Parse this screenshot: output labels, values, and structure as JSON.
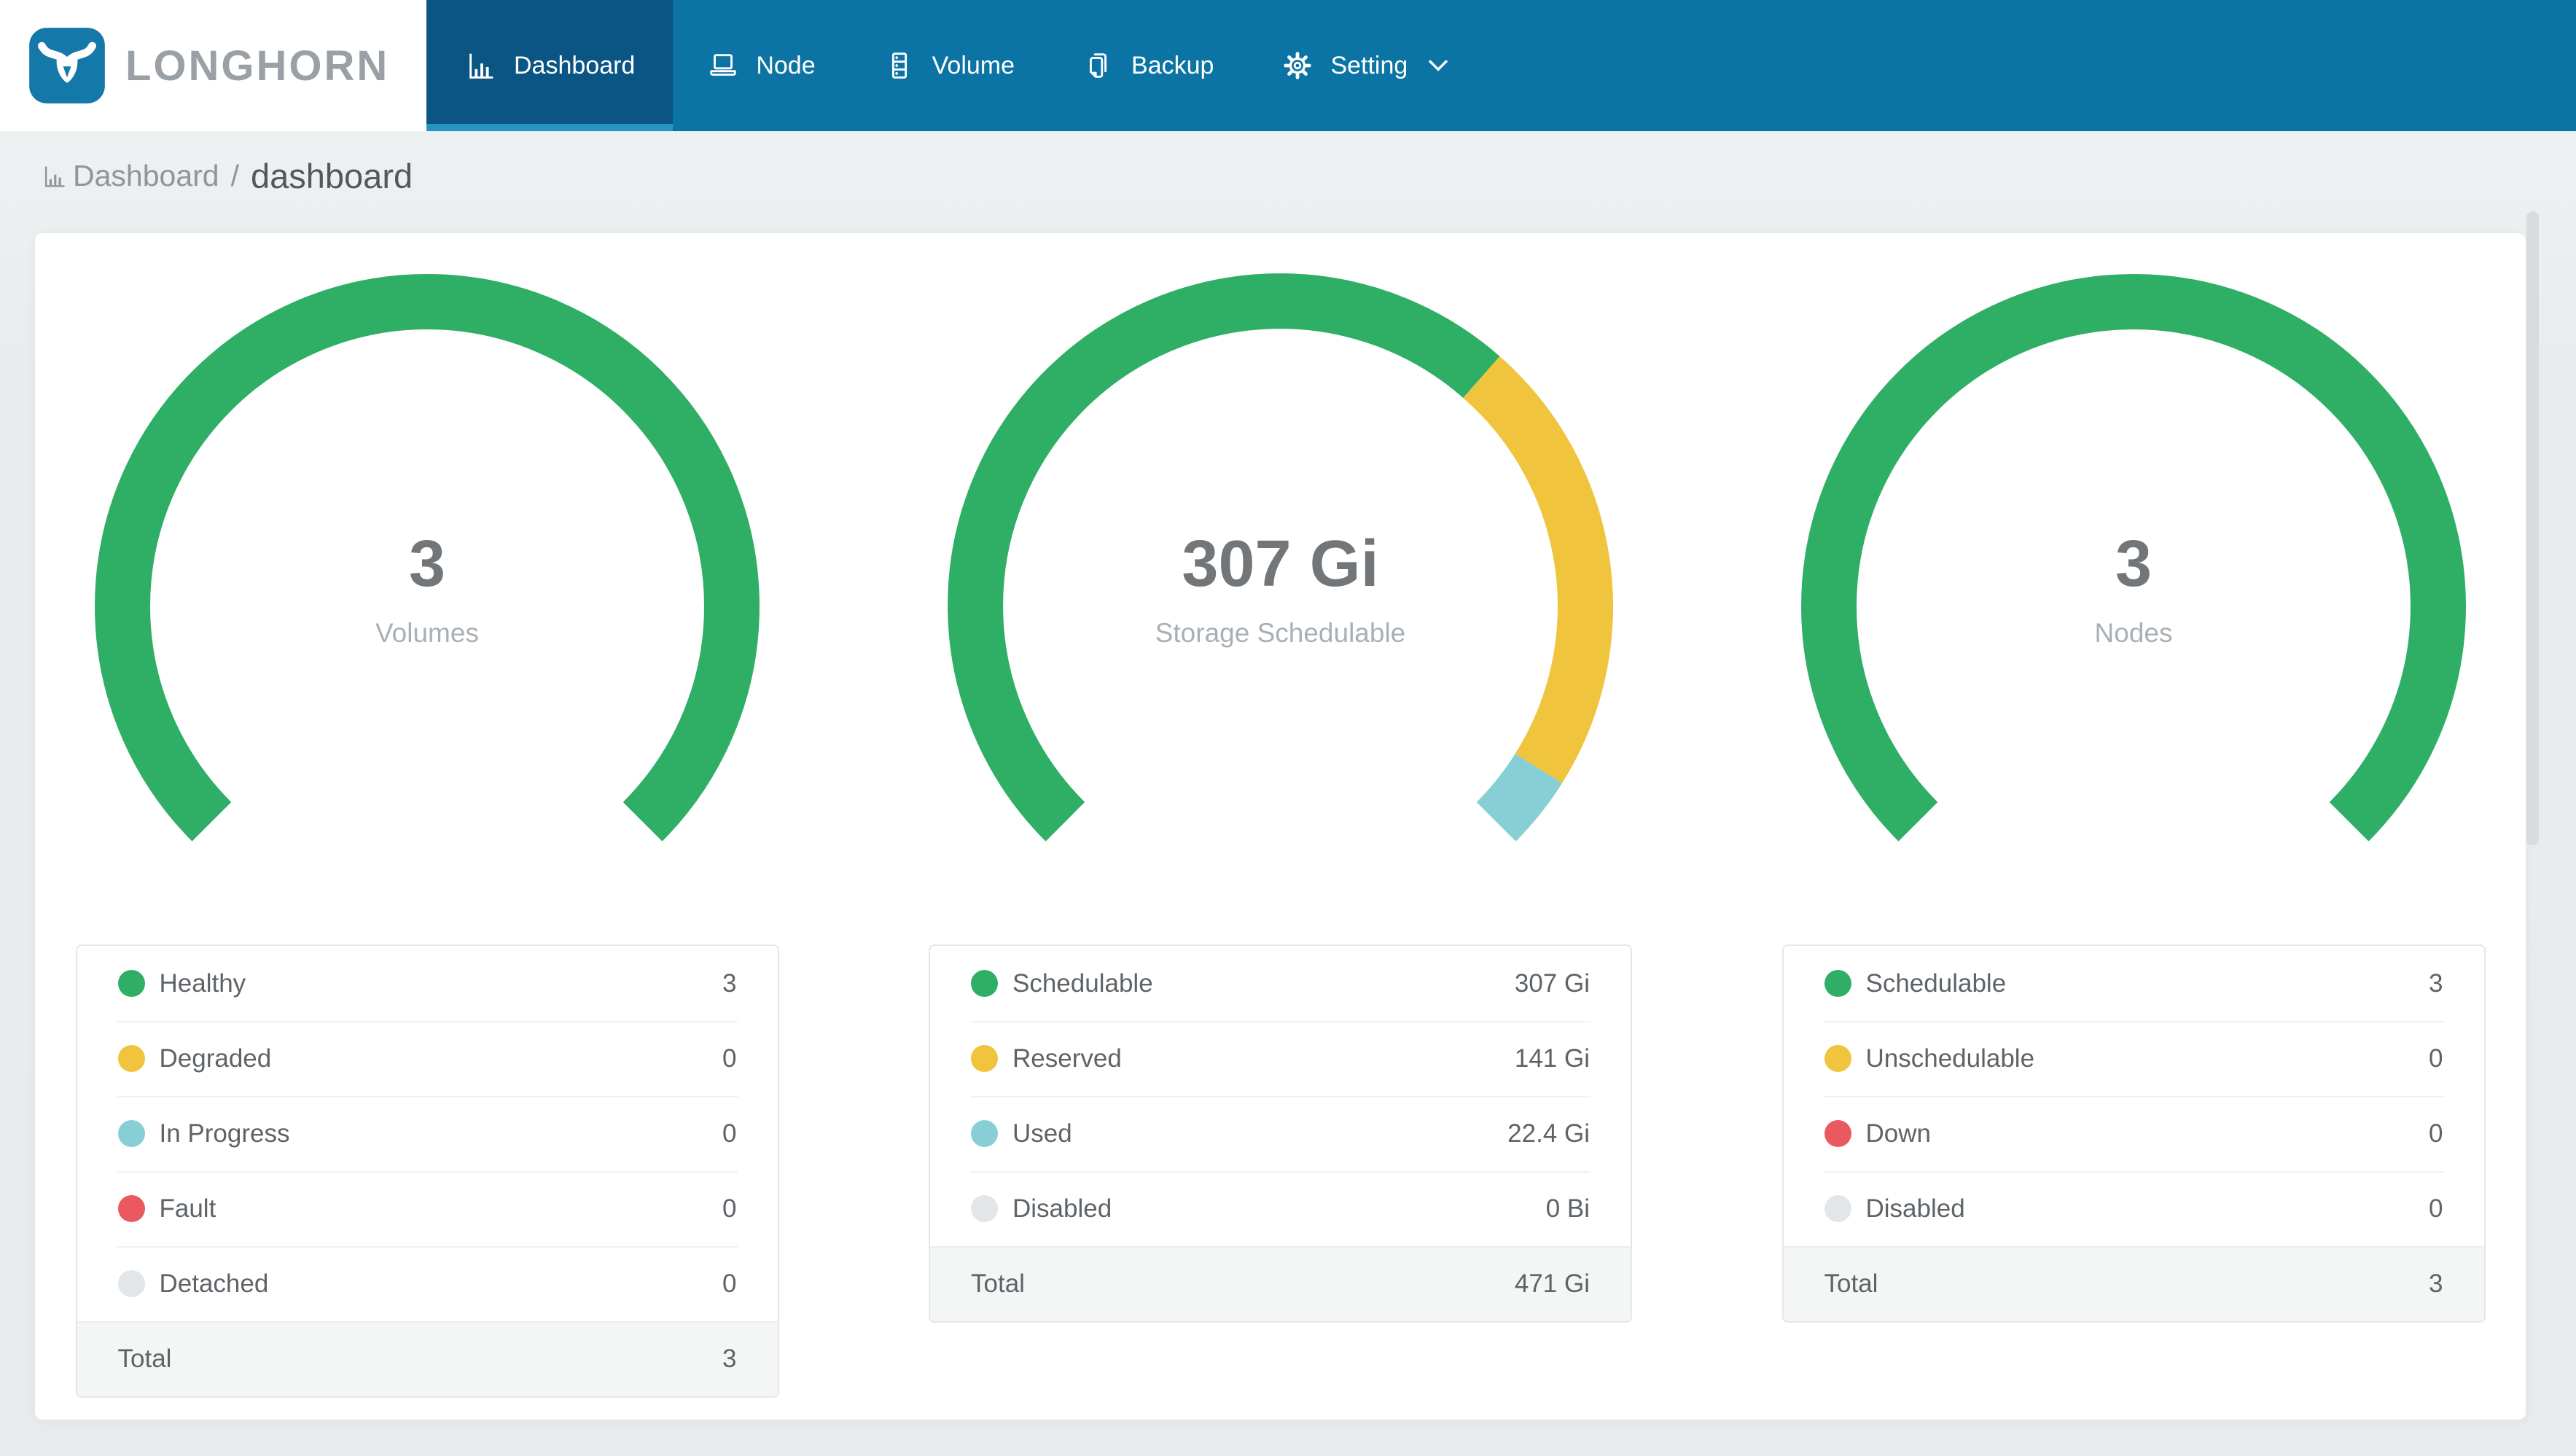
{
  "header": {
    "logo_text": "LONGHORN",
    "nav": [
      {
        "label": "Dashboard",
        "icon": "bar-chart",
        "active": true,
        "has_dropdown": false
      },
      {
        "label": "Node",
        "icon": "laptop",
        "active": false,
        "has_dropdown": false
      },
      {
        "label": "Volume",
        "icon": "server",
        "active": false,
        "has_dropdown": false
      },
      {
        "label": "Backup",
        "icon": "copy",
        "active": false,
        "has_dropdown": false
      },
      {
        "label": "Setting",
        "icon": "gear",
        "active": false,
        "has_dropdown": true
      }
    ]
  },
  "breadcrumb": {
    "section": "Dashboard",
    "separator": "/",
    "page": "dashboard",
    "icon": "bar-chart"
  },
  "colors": {
    "nav_bg": "#0b74a4",
    "nav_active_bg": "#0a5583",
    "nav_active_underline": "#2795c1",
    "green": "#2fae66",
    "yellow": "#f0c43c",
    "teal": "#87cfd5",
    "red": "#e9595f",
    "gray": "#e3e6e9"
  },
  "chart_data": [
    {
      "type": "gauge",
      "center_value": "3",
      "center_label": "Volumes",
      "arc_span_deg": 270,
      "segments": [
        {
          "label": "Healthy",
          "numeric": 3,
          "color_key": "green"
        }
      ],
      "legend_rows": [
        {
          "label": "Healthy",
          "value": "3",
          "color_key": "green"
        },
        {
          "label": "Degraded",
          "value": "0",
          "color_key": "yellow"
        },
        {
          "label": "In Progress",
          "value": "0",
          "color_key": "teal"
        },
        {
          "label": "Fault",
          "value": "0",
          "color_key": "red"
        },
        {
          "label": "Detached",
          "value": "0",
          "color_key": "gray"
        }
      ],
      "total": {
        "label": "Total",
        "value": "3"
      }
    },
    {
      "type": "gauge",
      "center_value": "307 Gi",
      "center_label": "Storage Schedulable",
      "arc_span_deg": 270,
      "segments": [
        {
          "label": "Schedulable",
          "numeric": 307,
          "color_key": "green"
        },
        {
          "label": "Reserved",
          "numeric": 141,
          "color_key": "yellow"
        },
        {
          "label": "Used",
          "numeric": 22.4,
          "color_key": "teal"
        }
      ],
      "legend_rows": [
        {
          "label": "Schedulable",
          "value": "307 Gi",
          "color_key": "green"
        },
        {
          "label": "Reserved",
          "value": "141 Gi",
          "color_key": "yellow"
        },
        {
          "label": "Used",
          "value": "22.4 Gi",
          "color_key": "teal"
        },
        {
          "label": "Disabled",
          "value": "0 Bi",
          "color_key": "gray"
        }
      ],
      "total": {
        "label": "Total",
        "value": "471 Gi"
      }
    },
    {
      "type": "gauge",
      "center_value": "3",
      "center_label": "Nodes",
      "arc_span_deg": 270,
      "segments": [
        {
          "label": "Schedulable",
          "numeric": 3,
          "color_key": "green"
        }
      ],
      "legend_rows": [
        {
          "label": "Schedulable",
          "value": "3",
          "color_key": "green"
        },
        {
          "label": "Unschedulable",
          "value": "0",
          "color_key": "yellow"
        },
        {
          "label": "Down",
          "value": "0",
          "color_key": "red"
        },
        {
          "label": "Disabled",
          "value": "0",
          "color_key": "gray"
        }
      ],
      "total": {
        "label": "Total",
        "value": "3"
      }
    }
  ]
}
